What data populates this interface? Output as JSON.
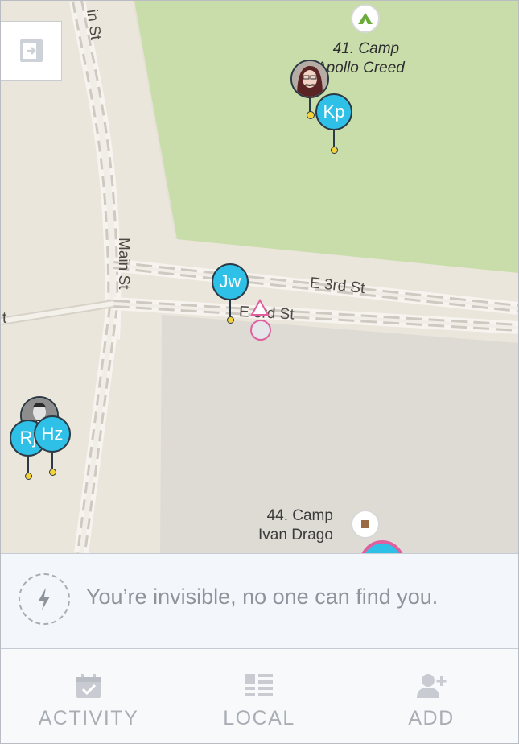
{
  "map": {
    "streets": {
      "main_st_upper": "in St",
      "main_st": "Main St",
      "e_3rd_st_upper": "E 3rd St",
      "e_3rd_st_lower": "E 3rd St",
      "left_stub": "t"
    },
    "pois": [
      {
        "line1": "41. Camp",
        "line2": "Apollo Creed",
        "icon": "tent-icon",
        "color": "#6aab3c"
      },
      {
        "line1": "44. Camp",
        "line2": "Ivan Drago",
        "icon": "square-icon",
        "color": "#9a6a44"
      }
    ],
    "markers": [
      {
        "initials": "Kp"
      },
      {
        "initials": "Jw"
      },
      {
        "initials": "Rj"
      },
      {
        "initials": "Hz"
      }
    ],
    "colors": {
      "park": "#c9ddaa",
      "land": "#ebe6dc",
      "building": "#dedbd5",
      "marker": "#2fc0e8",
      "self": "#e0609f"
    }
  },
  "exit_button": {
    "icon": "exit-icon"
  },
  "status": {
    "icon": "lightning-icon",
    "text": "You’re invisible, no one can find you."
  },
  "tabs": [
    {
      "label": "ACTIVITY",
      "icon": "calendar-check-icon"
    },
    {
      "label": "LOCAL",
      "icon": "list-icon"
    },
    {
      "label": "ADD",
      "icon": "add-user-icon"
    }
  ]
}
